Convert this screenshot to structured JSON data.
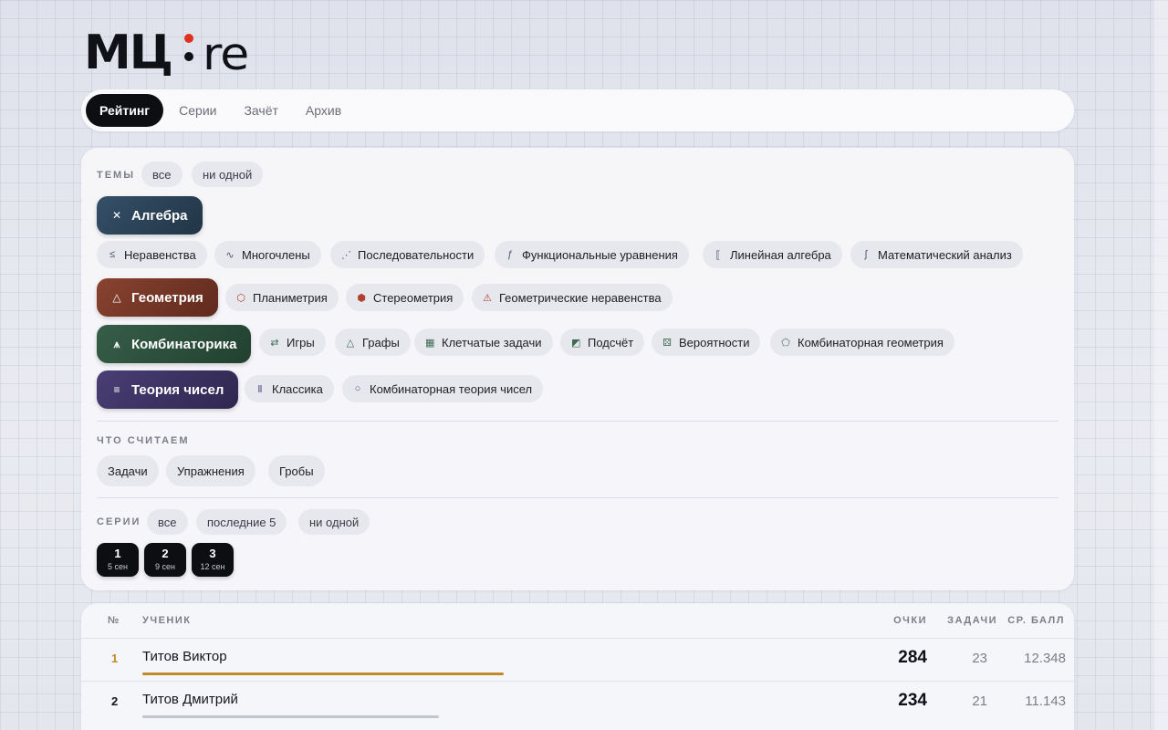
{
  "logo": {
    "part1": "МЦ",
    "part2": "re"
  },
  "nav": {
    "tabs": [
      "Рейтинг",
      "Серии",
      "Зачёт",
      "Архив"
    ],
    "active": "Рейтинг"
  },
  "filters": {
    "topics_label": "ТЕМЫ",
    "topics_all": "все",
    "topics_none": "ни одной",
    "groups": [
      {
        "label": "Алгебра",
        "icon": "cross-icon",
        "color": "#2c4458",
        "subtopics": [
          "Неравенства",
          "Многочлены",
          "Последовательности",
          "Функциональные уравнения",
          "Линейная алгебра",
          "Математический анализ"
        ]
      },
      {
        "label": "Геометрия",
        "icon": "triangle-icon",
        "color": "#7a3826",
        "subtopics": [
          "Планиметрия",
          "Стереометрия",
          "Геометрические неравенства"
        ]
      },
      {
        "label": "Комбинаторика",
        "icon": "tree-icon",
        "color": "#2d5240",
        "subtopics": [
          "Игры",
          "Графы",
          "Клетчатые задачи",
          "Подсчёт",
          "Вероятности",
          "Комбинаторная геометрия"
        ]
      },
      {
        "label": "Теория чисел",
        "icon": "equiv-icon",
        "color": "#3c3260",
        "subtopics": [
          "Классика",
          "Комбинаторная теория чисел"
        ]
      }
    ],
    "count_label": "ЧТО СЧИТАЕМ",
    "count_options": [
      "Задачи",
      "Упражнения",
      "Гробы"
    ],
    "series_label": "СЕРИИ",
    "series_all": "все",
    "series_last": "последние 5",
    "series_none": "ни одной",
    "series": [
      {
        "num": "1",
        "date": "5 сен"
      },
      {
        "num": "2",
        "date": "9 сен"
      },
      {
        "num": "3",
        "date": "12 сен"
      }
    ]
  },
  "table": {
    "headers": {
      "num": "№",
      "student": "УЧЕНИК",
      "points": "ОЧКИ",
      "tasks": "ЗАДАЧИ",
      "avg": "СР. БАЛЛ"
    },
    "rows": [
      {
        "rank": "1",
        "name": "Титов Виктор",
        "points": "284",
        "tasks": "23",
        "avg": "12.348",
        "share": 1.0,
        "color": "#c08a2a"
      },
      {
        "rank": "2",
        "name": "Титов Дмитрий",
        "points": "234",
        "tasks": "21",
        "avg": "11.143",
        "share": 0.82,
        "color": "#c3c5cc"
      }
    ]
  }
}
